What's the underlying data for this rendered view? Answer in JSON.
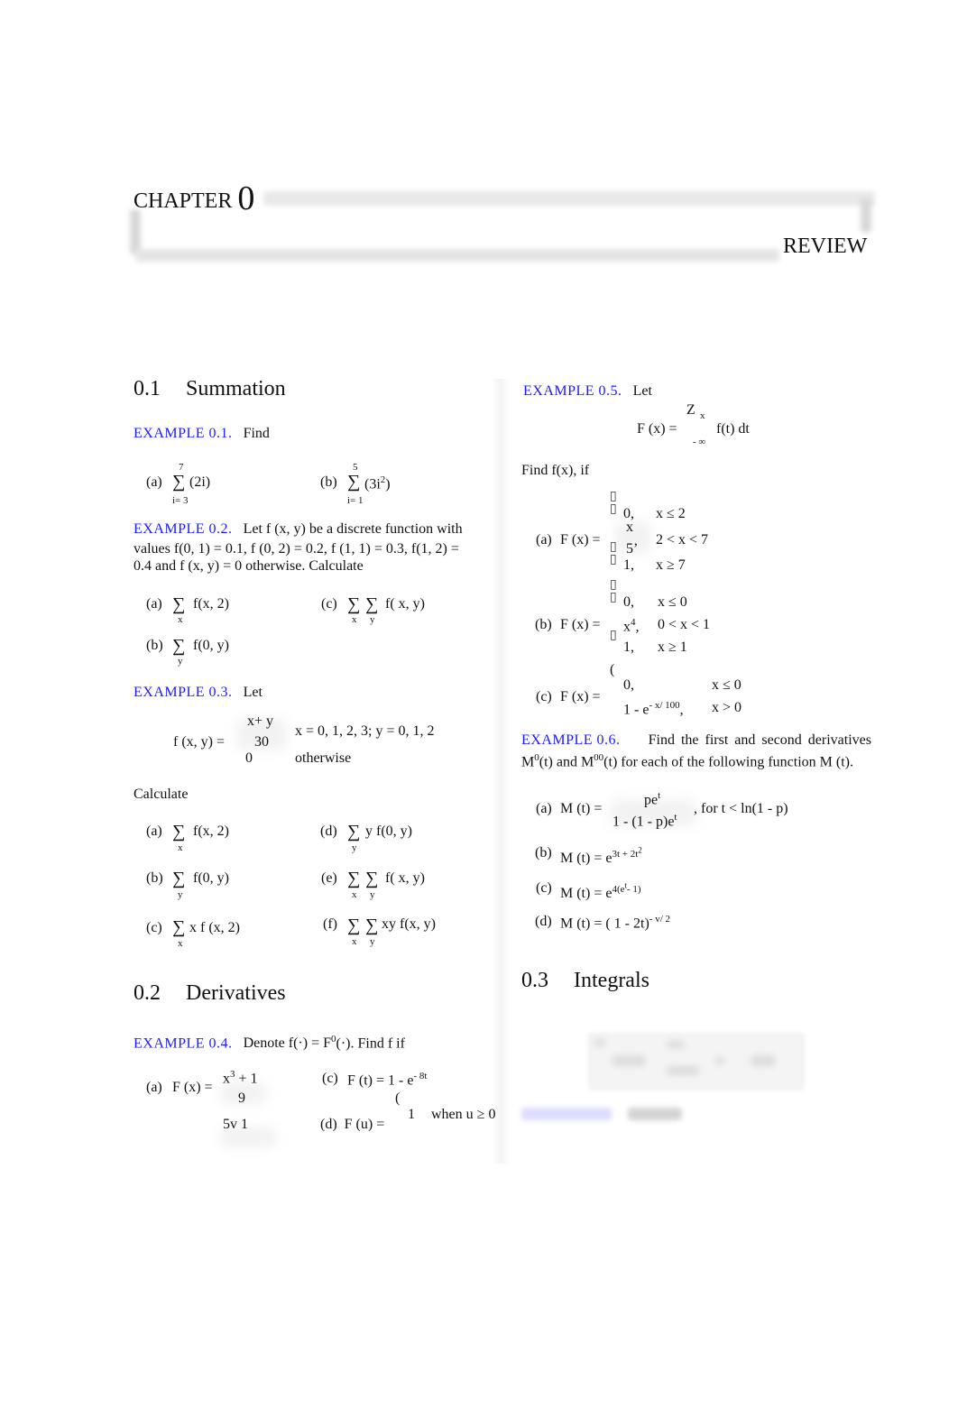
{
  "chapter": {
    "label": "CHAPTER",
    "number": "0",
    "title": "REVIEW"
  },
  "sections": {
    "s1": {
      "number": "0.1",
      "title": "Summation"
    },
    "s2": {
      "number": "0.2",
      "title": "Derivatives"
    },
    "s3": {
      "number": "0.3",
      "title": "Integrals"
    }
  },
  "ex1": {
    "label": "EXAMPLE 0.1.",
    "text": "Find",
    "a": {
      "tag": "(a)",
      "upper": "7",
      "lower": "i= 3",
      "body": "(2i)"
    },
    "b": {
      "tag": "(b)",
      "upper": "5",
      "lower": "i= 1",
      "body": "(3i",
      "exp": "2",
      "close": ")"
    }
  },
  "ex2": {
    "label": "EXAMPLE 0.2.",
    "line1": "Let  f (x, y) be a discrete function with",
    "line2": "values  f(0, 1) =  0.1,  f (0, 2) =  0.2,  f (1, 1) =  0.3,  f(1, 2) =",
    "line3": "0.4 and  f (x, y) =  0 otherwise. Calculate",
    "a": {
      "tag": "(a)",
      "sub": "x",
      "body": "f(x, 2)"
    },
    "b": {
      "tag": "(b)",
      "sub": "y",
      "body": "f(0, y)"
    },
    "c": {
      "tag": "(c)",
      "sub1": "x",
      "sub2": "y",
      "body": "f( x, y)"
    }
  },
  "ex3": {
    "label": "EXAMPLE 0.3.",
    "text": "Let",
    "lhs": "f (x, y) =",
    "num": "x+  y",
    "den": "30",
    "cond1": "x =  0, 1, 2, 3;  y =  0, 1, 2",
    "zero": "0",
    "cond2": "otherwise",
    "calc": "Calculate",
    "a": {
      "tag": "(a)",
      "sub": "x",
      "body": "f(x, 2)"
    },
    "b": {
      "tag": "(b)",
      "sub": "y",
      "body": "f(0, y)"
    },
    "c": {
      "tag": "(c)",
      "sub": "x",
      "body": "x f (x, 2)"
    },
    "d": {
      "tag": "(d)",
      "sub": "y",
      "body": "y f(0, y)"
    },
    "e": {
      "tag": "(e)",
      "sub1": "x",
      "sub2": "y",
      "body": "f( x, y)"
    },
    "f": {
      "tag": "(f)",
      "sub1": "x",
      "sub2": "y",
      "body": "xy f(x, y)"
    }
  },
  "ex4": {
    "label": "EXAMPLE 0.4.",
    "text": "Denote  f(·) =  F",
    "prime": "0",
    "text2": "(·). Find  f  if",
    "a": {
      "tag": "(a)",
      "lhs": "F (x) =",
      "num": "x",
      "numexp": "3",
      "numrest": " + 1",
      "den": "9",
      "next": "5v     1"
    },
    "c": {
      "tag": "(c)",
      "lhs": "F (t) =  1 -  e",
      "exp": "- 8t"
    },
    "d": {
      "tag": "(d)",
      "lhs": "F (u) =",
      "brace": "(",
      "val": "1",
      "cond": "when u ≥  0"
    }
  },
  "ex5": {
    "label": "EXAMPLE 0.5.",
    "text": "Let",
    "lhs": "F (x) =",
    "int": "Z",
    "upper": "x",
    "lower": "- ∞",
    "integrand": "f(t)  dt",
    "find": "Find  f(x), if",
    "a": {
      "tag": "(a)",
      "lhs": "F (x) =",
      "r1v": "0,",
      "r1c": "x ≤  2",
      "r2n": "x",
      "r2d": "5",
      "r2c": "2 <  x <  7",
      "r3v": "1,",
      "r3c": "x ≥  7"
    },
    "b": {
      "tag": "(b)",
      "lhs": "F (x) =",
      "r1v": "0,",
      "r1c": "x ≤  0",
      "r2v": "x",
      "r2exp": "4",
      "r2comma": ",",
      "r2c": "0 <  x <  1",
      "r3v": "1,",
      "r3c": "x ≥  1"
    },
    "c": {
      "tag": "(c)",
      "lhs": "F (x) =",
      "brace": "(",
      "r1v": "0,",
      "r1c": "x ≤  0",
      "r2v": "1 -   e",
      "r2exp": "- x/ 100",
      "r2comma": ",",
      "r2c": "x >  0"
    }
  },
  "ex6": {
    "label": "EXAMPLE 0.6.",
    "line1": "Find the first and second derivatives",
    "line2a": "M",
    "p1": "0",
    "line2b": "(t) and M",
    "p2": "00",
    "line2c": "(t) for each of the following function M (t).",
    "a": {
      "tag": "(a)",
      "lhs": "M (t) =",
      "num": "pe",
      "numexp": "t",
      "den": "1 -  (1 -  p)e",
      "denexp": "t",
      "tail": ",  for t <  ln(1 -  p)"
    },
    "b": {
      "tag": "(b)",
      "lhs": "M (t) =  e",
      "exp": "3t + 2t",
      "exp2": "2"
    },
    "c": {
      "tag": "(c)",
      "lhs": "M (t) =  e",
      "exp": "4(e",
      "exp2": "t",
      "exp3": "- 1)"
    },
    "d": {
      "tag": "(d)",
      "lhs": "M (t) = ( 1 -  2t)",
      "exp": "-  v/ 2"
    }
  }
}
